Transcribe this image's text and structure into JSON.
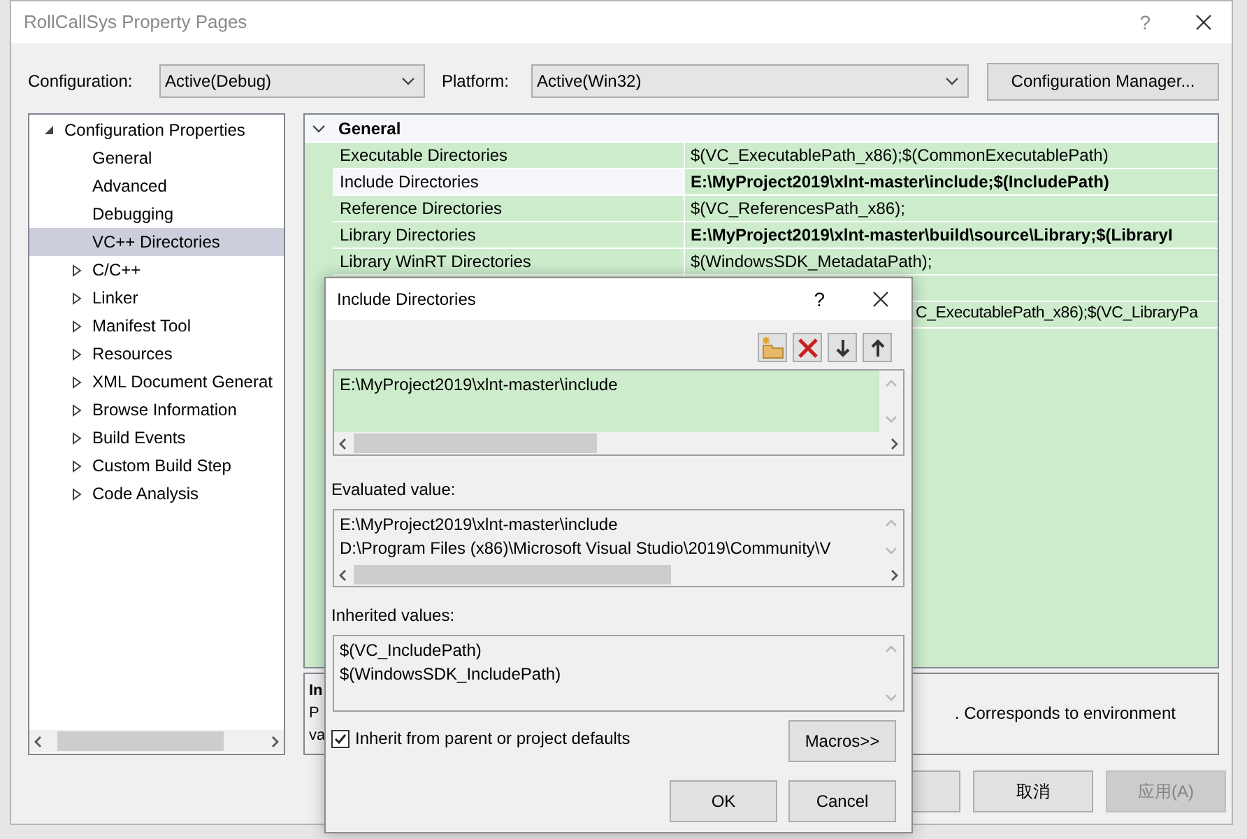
{
  "window": {
    "title": "RollCallSys Property Pages",
    "help": "?"
  },
  "configuration": {
    "label": "Configuration:",
    "value": "Active(Debug)"
  },
  "platform": {
    "label": "Platform:",
    "value": "Active(Win32)"
  },
  "configuration_manager_button": "Configuration Manager...",
  "tree": {
    "items": [
      {
        "label": "Configuration Properties",
        "expanded": true,
        "children": [
          {
            "label": "General",
            "selected": false
          },
          {
            "label": "Advanced",
            "selected": false
          },
          {
            "label": "Debugging",
            "selected": false
          },
          {
            "label": "VC++ Directories",
            "selected": true
          },
          {
            "label": "C/C++",
            "selected": false,
            "expanded": false
          },
          {
            "label": "Linker",
            "selected": false,
            "expanded": false
          },
          {
            "label": "Manifest Tool",
            "selected": false,
            "expanded": false
          },
          {
            "label": "Resources",
            "selected": false,
            "expanded": false
          },
          {
            "label": "XML Document Generat",
            "selected": false,
            "expanded": false
          },
          {
            "label": "Browse Information",
            "selected": false,
            "expanded": false
          },
          {
            "label": "Build Events",
            "selected": false,
            "expanded": false
          },
          {
            "label": "Custom Build Step",
            "selected": false,
            "expanded": false
          },
          {
            "label": "Code Analysis",
            "selected": false,
            "expanded": false
          }
        ]
      }
    ]
  },
  "property_grid": {
    "category": {
      "label": "General",
      "expanded": true
    },
    "rows": [
      {
        "name": "Executable Directories",
        "value": "$(VC_ExecutablePath_x86);$(CommonExecutablePath)",
        "selected": false,
        "modified": false
      },
      {
        "name": "Include Directories",
        "value": "E:\\MyProject2019\\xlnt-master\\include;$(IncludePath)",
        "selected": true,
        "modified": true
      },
      {
        "name": "Reference Directories",
        "value": "$(VC_ReferencesPath_x86);",
        "selected": false,
        "modified": false
      },
      {
        "name": "Library Directories",
        "value": "E:\\MyProject2019\\xlnt-master\\build\\source\\Library;$(LibraryI",
        "selected": false,
        "modified": true
      },
      {
        "name": "Library WinRT Directories",
        "value": "$(WindowsSDK_MetadataPath);",
        "selected": false,
        "modified": false
      }
    ],
    "covered_rows": [
      {
        "value_tail": "C_ExecutablePath_x86);$(VC_LibraryPa"
      }
    ]
  },
  "description": {
    "title": "In",
    "lines": [
      "P",
      "va"
    ],
    "tail": ".  Corresponds to environment"
  },
  "buttons": [
    {
      "label": "取消",
      "disabled": false
    },
    {
      "label": "应用(A)",
      "disabled": true
    }
  ],
  "dialog": {
    "title": "Include Directories",
    "help": "?",
    "entries": [
      "E:\\MyProject2019\\xlnt-master\\include"
    ],
    "evaluated_label": "Evaluated value:",
    "evaluated": [
      "E:\\MyProject2019\\xlnt-master\\include",
      "D:\\Program Files (x86)\\Microsoft Visual Studio\\2019\\Community\\V"
    ],
    "inherited_label": "Inherited values:",
    "inherited": [
      "$(VC_IncludePath)",
      "$(WindowsSDK_IncludePath)"
    ],
    "inherit_checkbox": {
      "label": "Inherit from parent or project defaults",
      "checked": true
    },
    "macros_button": "Macros>>",
    "buttons": [
      "OK",
      "Cancel"
    ]
  }
}
